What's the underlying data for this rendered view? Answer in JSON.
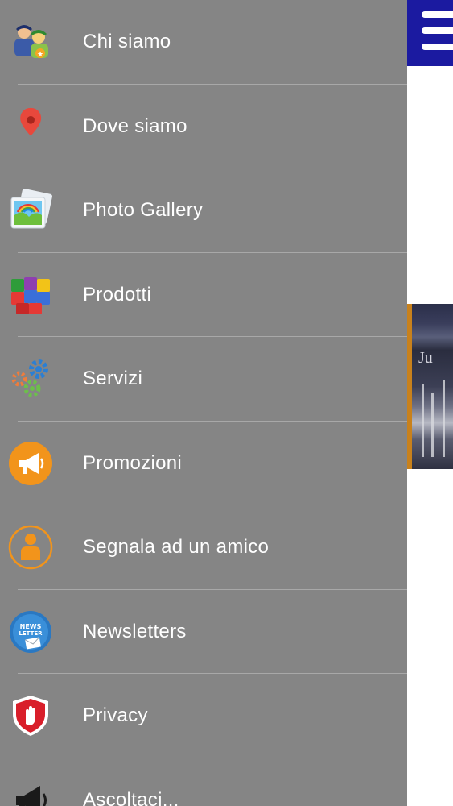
{
  "menu": {
    "items": [
      {
        "label": "Chi siamo",
        "icon": "people-icon"
      },
      {
        "label": "Dove siamo",
        "icon": "map-pin-icon"
      },
      {
        "label": "Photo Gallery",
        "icon": "photo-gallery-icon"
      },
      {
        "label": "Prodotti",
        "icon": "cubes-icon"
      },
      {
        "label": "Servizi",
        "icon": "gears-icon"
      },
      {
        "label": "Promozioni",
        "icon": "megaphone-circle-icon"
      },
      {
        "label": "Segnala ad un amico",
        "icon": "person-circle-icon"
      },
      {
        "label": "Newsletters",
        "icon": "newsletter-icon"
      },
      {
        "label": "Privacy",
        "icon": "shield-hand-icon"
      },
      {
        "label": "Ascoltaci...",
        "icon": "megaphone-icon"
      }
    ]
  },
  "colors": {
    "drawer_bg": "#858585",
    "header_bar": "#1b1aa0",
    "label_text": "#ffffff"
  },
  "page": {
    "photo_text": "Ju"
  }
}
